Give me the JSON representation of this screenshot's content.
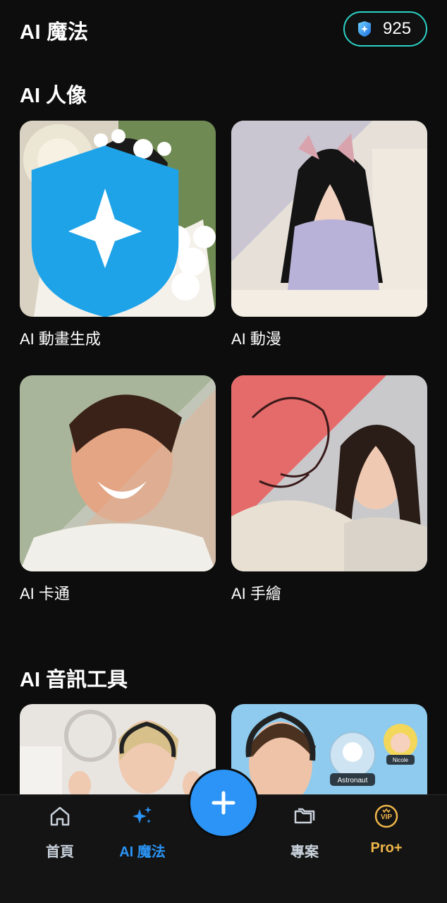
{
  "header": {
    "title": "AI 魔法",
    "credits": "925"
  },
  "sections": {
    "portrait": {
      "title": "AI 人像",
      "cards": [
        {
          "label": "AI 動畫生成"
        },
        {
          "label": "AI 動漫"
        },
        {
          "label": "AI 卡通"
        },
        {
          "label": "AI 手繪"
        }
      ]
    },
    "audio": {
      "title": "AI 音訊工具",
      "chips": [
        "Astronaut",
        "Nicole"
      ]
    }
  },
  "tabs": [
    {
      "label": "首頁",
      "icon": "home-icon"
    },
    {
      "label": "AI 魔法",
      "icon": "sparkle-icon"
    },
    {
      "label": "專案",
      "icon": "folder-icon"
    },
    {
      "label": "Pro+",
      "icon": "vip-icon"
    }
  ],
  "fab": {
    "icon": "plus-icon"
  },
  "colors": {
    "accent_blue": "#2b94f6",
    "teal_border": "#2bd2c6",
    "pro_gold": "#f0b64a",
    "background": "#0d0d0d"
  }
}
